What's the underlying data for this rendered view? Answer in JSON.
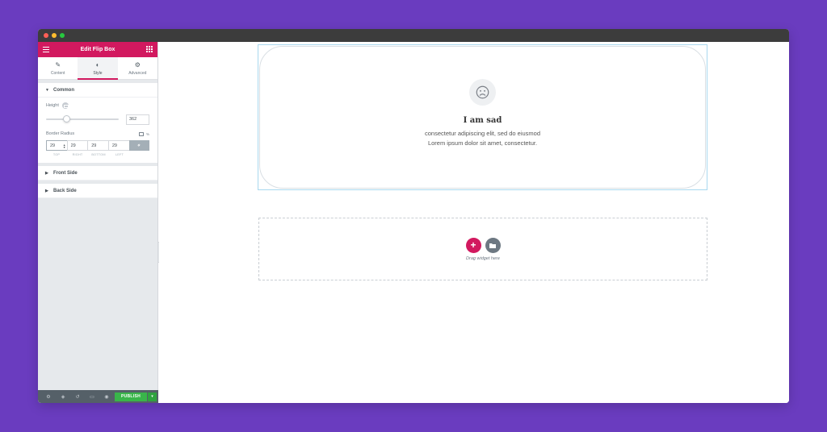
{
  "panel": {
    "title": "Edit Flip Box",
    "tabs": [
      {
        "label": "Content",
        "icon": "pencil-icon"
      },
      {
        "label": "Style",
        "icon": "contrast-icon"
      },
      {
        "label": "Advanced",
        "icon": "gear-icon"
      }
    ],
    "active_tab": "Style",
    "sections": {
      "common": {
        "title": "Common",
        "height_label": "Height",
        "height_value": "362",
        "height_slider_fraction": 0.28,
        "border_radius_label": "Border Radius",
        "border_radius_unit": "%",
        "border_radius_values": [
          "29",
          "29",
          "29",
          "29"
        ],
        "border_radius_sides": [
          "TOP",
          "RIGHT",
          "BOTTOM",
          "LEFT"
        ]
      },
      "front_side": {
        "title": "Front Side"
      },
      "back_side": {
        "title": "Back Side"
      }
    },
    "footer": {
      "publish_label": "PUBLISH",
      "icons": [
        "gear-icon",
        "layers-icon",
        "history-icon",
        "desktop-icon",
        "eye-icon"
      ]
    }
  },
  "canvas": {
    "flipbox": {
      "icon": "sad-face-icon",
      "title": "I am sad",
      "description": "consectetur adipiscing elit, sed do eiusmod Lorem ipsum dolor sit amet, consectetur."
    },
    "dropzone": {
      "text": "Drag widget here"
    }
  },
  "colors": {
    "background": "#6a3cbf",
    "accent": "#d2195f",
    "publish": "#39b54a"
  }
}
